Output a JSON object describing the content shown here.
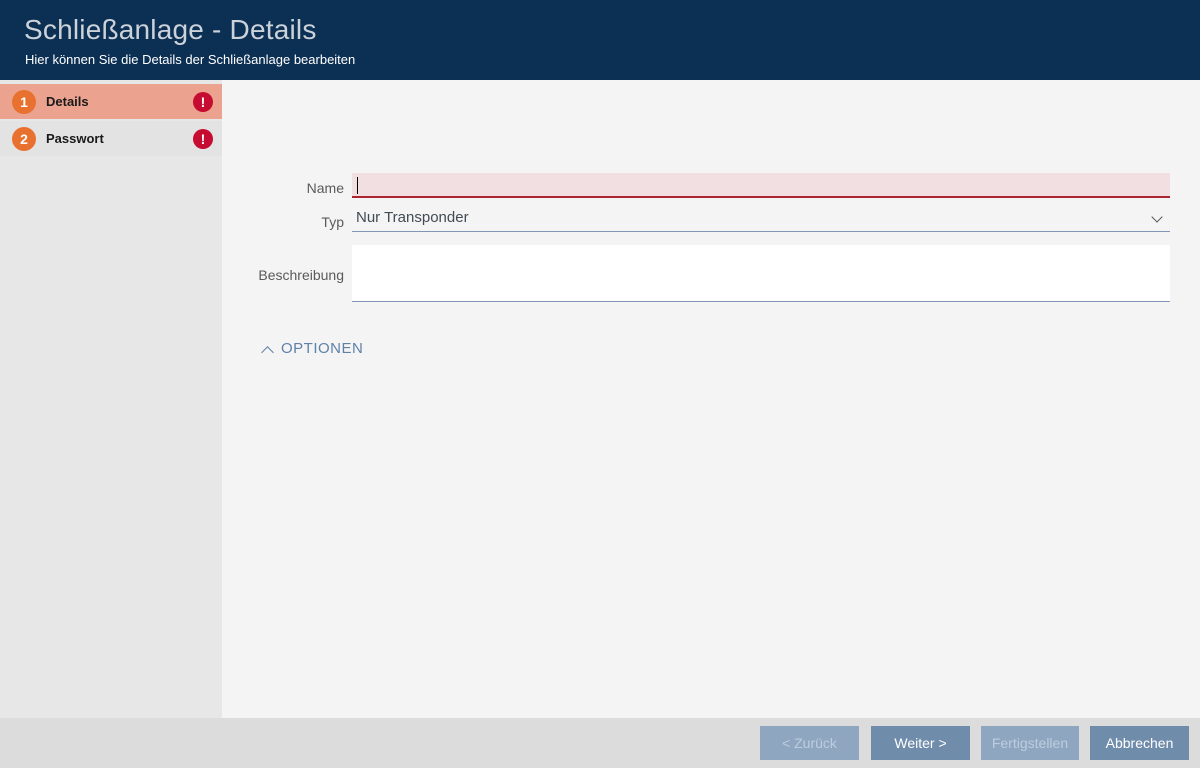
{
  "header": {
    "title": "Schließanlage - Details",
    "subtitle": "Hier können Sie die Details der Schließanlage bearbeiten"
  },
  "steps": [
    {
      "number": "1",
      "label": "Details",
      "state": "active",
      "error_badge": "!"
    },
    {
      "number": "2",
      "label": "Passwort",
      "state": "inactive",
      "error_badge": "!"
    }
  ],
  "form": {
    "name_label": "Name",
    "name_value": "",
    "typ_label": "Typ",
    "typ_value": "Nur Transponder",
    "beschreibung_label": "Beschreibung",
    "beschreibung_value": "",
    "optionen_label": "OPTIONEN"
  },
  "footer": {
    "back_label": "< Zurück",
    "next_label": "Weiter >",
    "finish_label": "Fertigstellen",
    "cancel_label": "Abbrechen"
  },
  "colors": {
    "header_bg": "#0c2f54",
    "active_step_bg": "#eba28e",
    "step_circle_orange": "#e8712f",
    "error_badge_red": "#c60c30",
    "name_error_bg": "#f2dfe1",
    "name_error_border": "#aa2530",
    "field_border_blue": "#8196b5",
    "accent_blue": "#5e81a9",
    "button_enabled_bg": "#6f8cab",
    "button_disabled_bg": "#8fa6c0",
    "footer_bg": "#dcdcdc"
  }
}
